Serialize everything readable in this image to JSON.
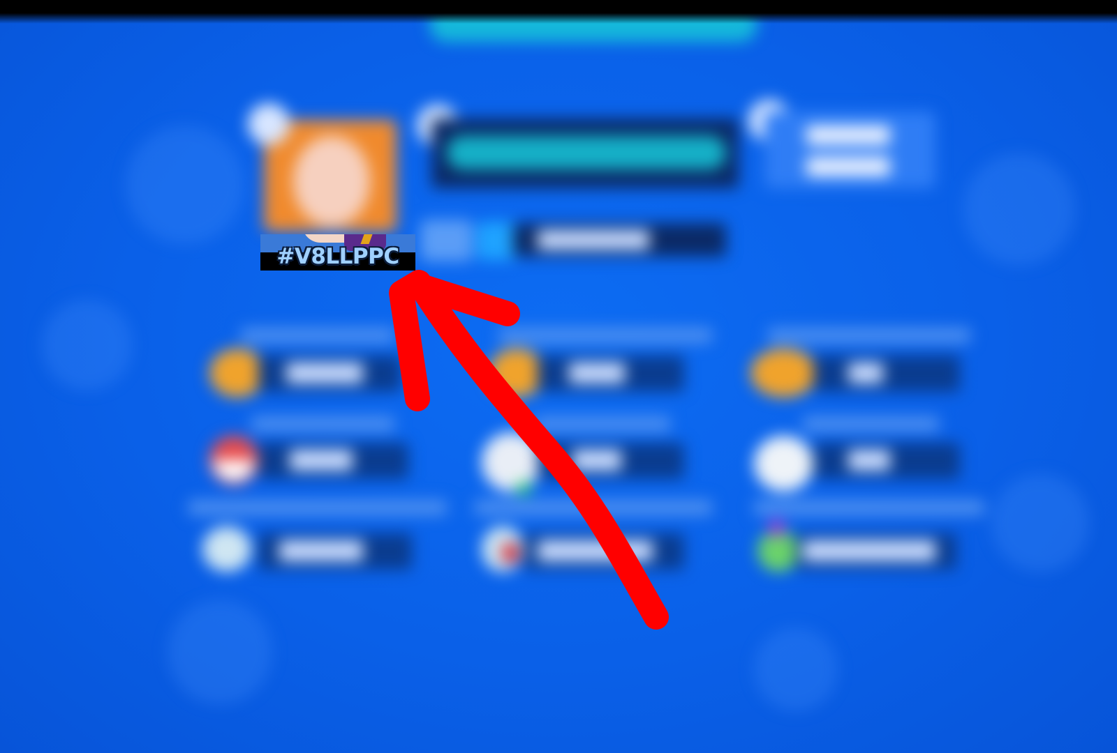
{
  "player": {
    "tag": "#V8LLPPC"
  },
  "annotation": {
    "arrow_color": "#ff0000",
    "target": "player-tag"
  },
  "theme": {
    "background": "#0a60e8",
    "accent_cyan": "#17c8d8"
  }
}
